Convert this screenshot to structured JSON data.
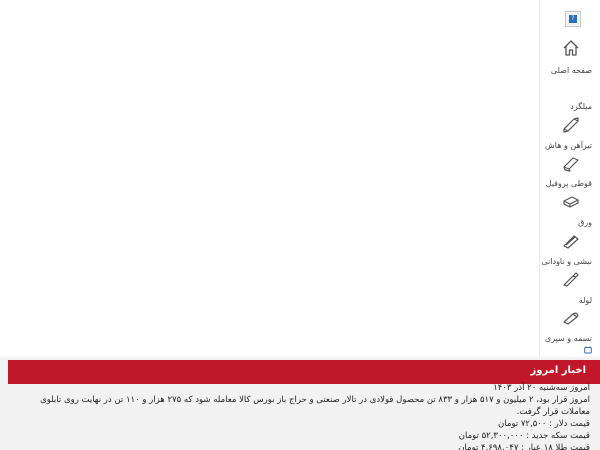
{
  "sidebar": {
    "logo_glyph": "?",
    "items": [
      {
        "label": "صفحه اصلی",
        "icon": "home-icon"
      },
      {
        "label": "میلگرد",
        "icon": "rebar-icon"
      },
      {
        "label": "تیرآهن و هاش",
        "icon": "beam-icon"
      },
      {
        "label": "قوطی پروفیل",
        "icon": "profile-box-icon"
      },
      {
        "label": "ورق",
        "icon": "sheet-icon"
      },
      {
        "label": "نبشی و ناودانی",
        "icon": "angle-icon"
      },
      {
        "label": "لوله",
        "icon": "pipe-icon"
      },
      {
        "label": "تسمه و سپری",
        "icon": "strip-icon"
      }
    ]
  },
  "news": {
    "title": "اخبار امروز",
    "date_line": "امروز سه‌شنبه ۲۰ آذر ۱۴۰۳",
    "body_line": "امروز قرار بود، ۲ میلیون و ۵۱۷ هزار و ۸۳۳ تن محصول فولادی در تالار صنعتی و حراج باز بورس کالا معامله شود که ۲۷۵ هزار و ۱۱۰ تن در نهایت روی تابلوی معاملات قرار گرفت.",
    "dollar_line": "قیمت دلار : ۷۲,۵۰۰ تومان",
    "coin_line": "قیمت سکه جدید : ۵۲,۳۰۰,۰۰۰ تومان",
    "gold_line": "قیمت طلا ۱۸ عیار : ۴,۶۹۸,۰۴۷ تومان"
  },
  "colors": {
    "accent": "#c0182a",
    "icon_stroke": "#555555",
    "chat_icon": "#2b6fb8"
  }
}
